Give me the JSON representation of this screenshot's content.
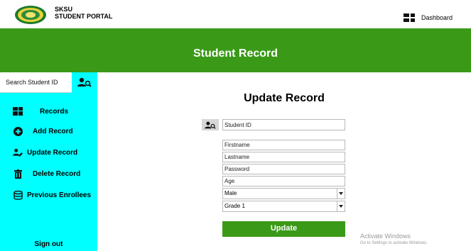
{
  "brand": {
    "line1": "SKSU",
    "line2": "STUDENT PORTAL"
  },
  "topbar": {
    "dashboard_label": "Dashboard"
  },
  "header": {
    "title": "Student Record"
  },
  "sidebar": {
    "search_value": "Search Student ID",
    "items": [
      {
        "label": "Records",
        "icon": "grid-icon"
      },
      {
        "label": "Add Record",
        "icon": "plus-circle-icon"
      },
      {
        "label": "Update Record",
        "icon": "edit-user-icon"
      },
      {
        "label": "Delete Record",
        "icon": "trash-icon"
      },
      {
        "label": "Previous Enrollees",
        "icon": "database-icon"
      }
    ],
    "signout_label": "Sign out"
  },
  "form": {
    "title": "Update Record",
    "student_id_placeholder": "Student ID",
    "firstname_placeholder": "Firstname",
    "lastname_placeholder": "Lastname",
    "password_placeholder": "Password",
    "age_placeholder": "Age",
    "gender_selected": "Male",
    "grade_selected": "Grade 1",
    "update_label": "Update"
  },
  "watermark": {
    "line1": "Activate Windows",
    "line2": "Go to Settings to activate Windows."
  },
  "colors": {
    "green": "#3a9a17",
    "cyan": "#00ffff"
  }
}
